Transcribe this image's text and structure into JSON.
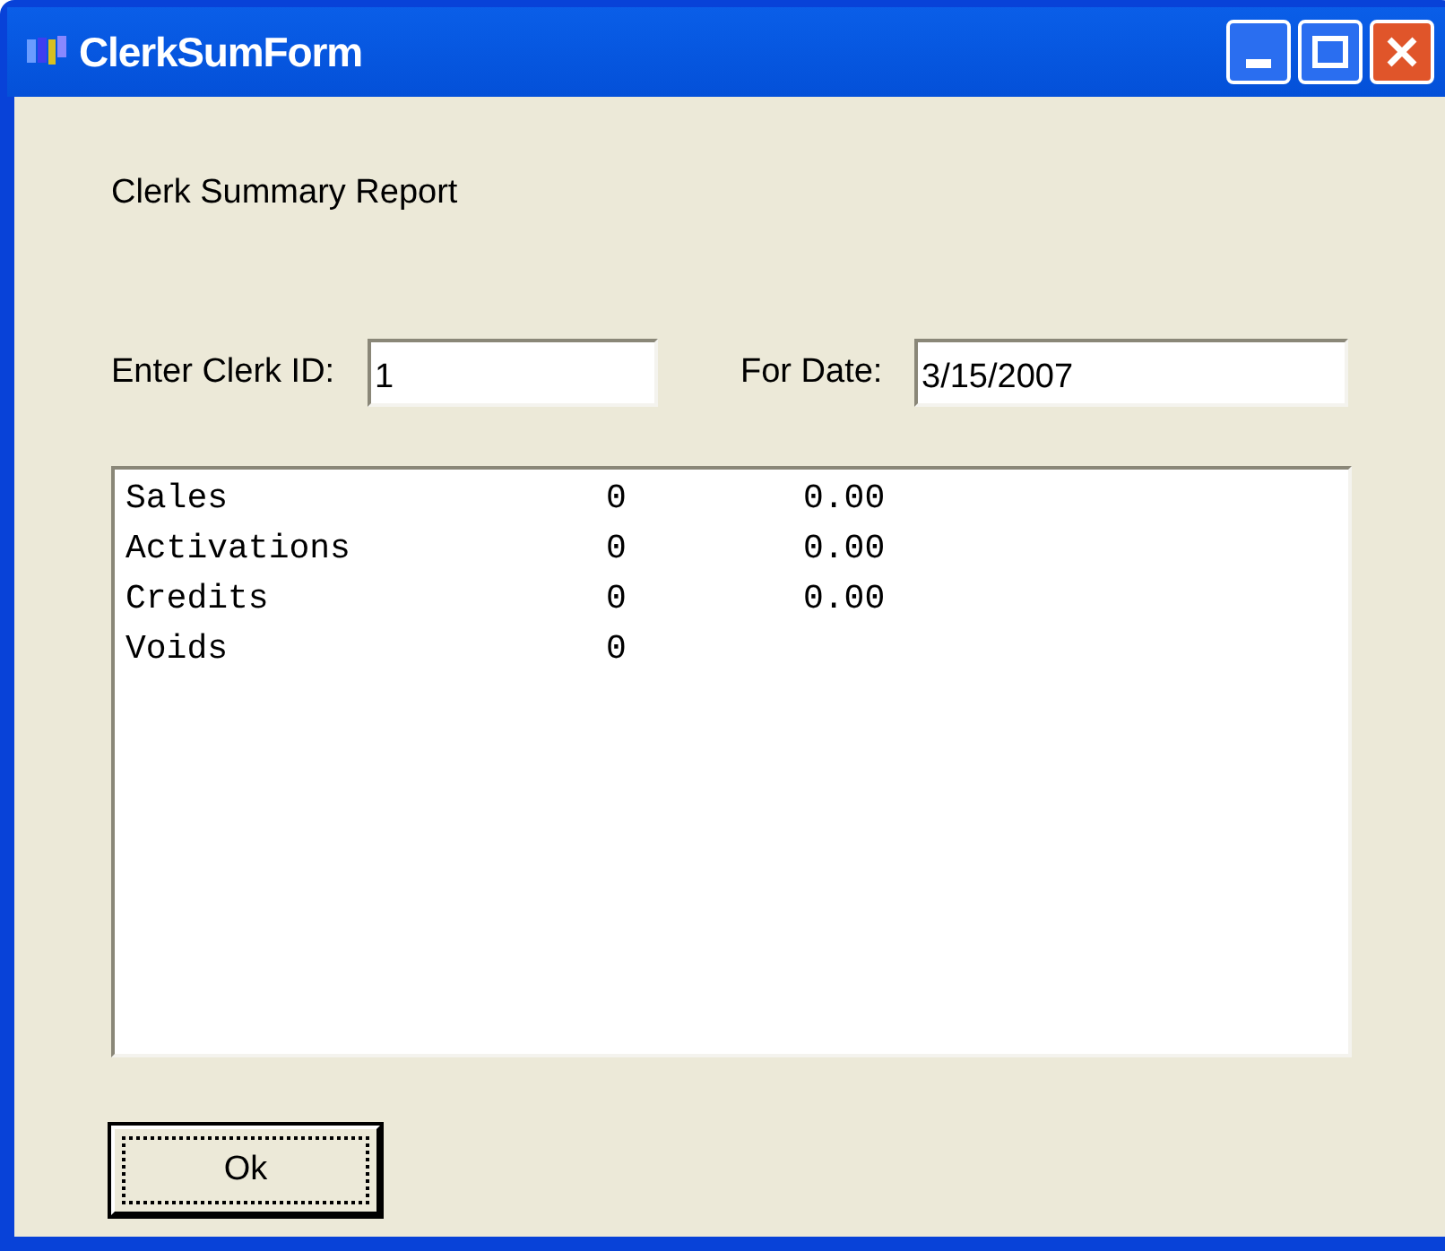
{
  "window": {
    "title": "ClerkSumForm"
  },
  "heading": "Clerk Summary Report",
  "clerk_id": {
    "label": "Enter Clerk ID:",
    "value": "1"
  },
  "for_date": {
    "label": "For Date:",
    "value": "3/15/2007"
  },
  "report_rows": [
    {
      "name": "Sales",
      "count": "0",
      "amount": "0.00"
    },
    {
      "name": "Activations",
      "count": "0",
      "amount": "0.00"
    },
    {
      "name": "Credits",
      "count": "0",
      "amount": "0.00"
    },
    {
      "name": "Voids",
      "count": "0"
    }
  ],
  "buttons": [
    {
      "label": "Ok",
      "focused": true
    }
  ]
}
